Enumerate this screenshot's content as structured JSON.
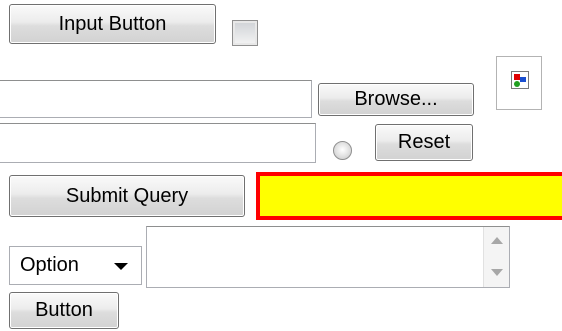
{
  "form": {
    "input_button_label": "Input Button",
    "browse_label": "Browse...",
    "reset_label": "Reset",
    "submit_label": "Submit Query",
    "select_value": "Option",
    "button_label": "Button",
    "file_input_value": "",
    "text_input_value": "",
    "highlighted_input_value": "",
    "textarea_value": "",
    "checkbox_checked": false,
    "radio_checked": false
  },
  "icons": {
    "broken_image": "broken-image-icon",
    "dropdown_arrow": "chevron-down-icon",
    "scroll_up": "scroll-up-arrow",
    "scroll_down": "scroll-down-arrow"
  },
  "colors": {
    "highlight_fill": "#ffff00",
    "highlight_border": "#ff0000"
  }
}
